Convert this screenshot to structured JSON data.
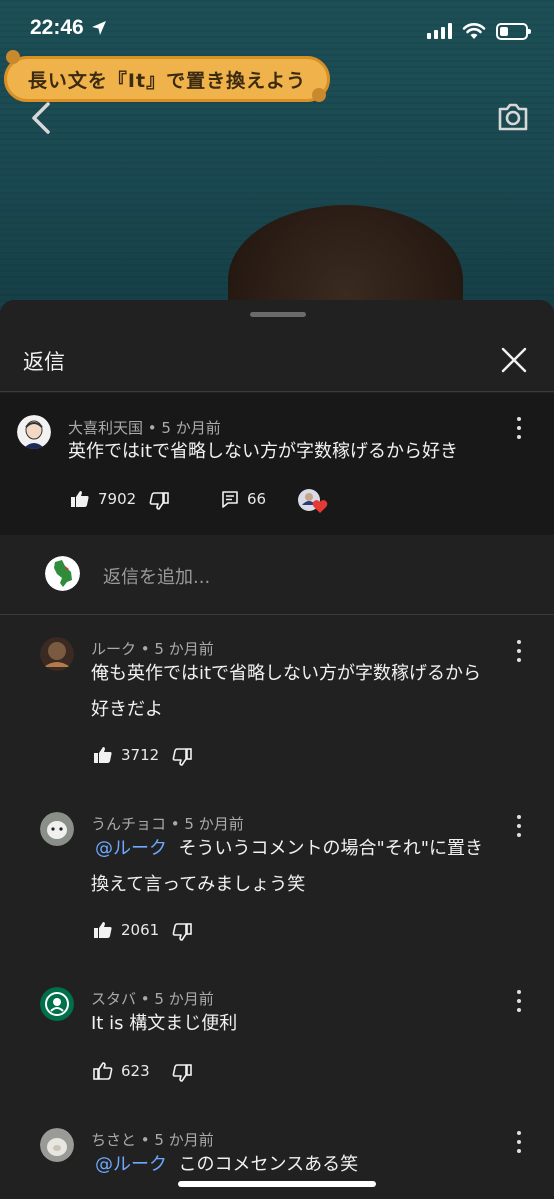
{
  "status_bar": {
    "time": "22:46"
  },
  "video": {
    "caption": "長い文を『It』で置き換えよう"
  },
  "panel": {
    "title": "返信"
  },
  "parent_comment": {
    "author_meta": "大喜利天国 • 5 か月前",
    "text": "英作ではitで省略しない方が字数稼げるから好き",
    "likes": "7902",
    "replies": "66"
  },
  "add_reply": {
    "placeholder": "返信を追加..."
  },
  "replies": [
    {
      "author_meta": "ルーク • 5 か月前",
      "mention": "",
      "line1": "俺も英作ではitで省略しない方が字数稼げるから",
      "line2": "好きだよ",
      "likes": "3712"
    },
    {
      "author_meta": "うんチョコ • 5 か月前",
      "mention": "@ルーク",
      "line1": "そういうコメントの場合\"それ\"に置き",
      "line2": "換えて言ってみましょう笑",
      "likes": "2061"
    },
    {
      "author_meta": "スタバ • 5 か月前",
      "mention": "",
      "line1": "It is 構文まじ便利",
      "line2": "",
      "likes": "623"
    },
    {
      "author_meta": "ちさと • 5 か月前",
      "mention": "@ルーク",
      "line1": "このコメセンスある笑",
      "line2": "",
      "likes": ""
    }
  ],
  "colors": {
    "mention": "#6ea8ff",
    "panel_bg": "#212121",
    "parent_bg": "#181818",
    "heart": "#e53935"
  },
  "icons": [
    "location-arrow-icon",
    "signal-icon",
    "wifi-icon",
    "battery-icon",
    "back-chevron-icon",
    "camera-icon",
    "close-icon",
    "thumb-up-icon",
    "thumb-down-icon",
    "reply-icon",
    "more-vert-icon",
    "creator-heart-icon"
  ]
}
